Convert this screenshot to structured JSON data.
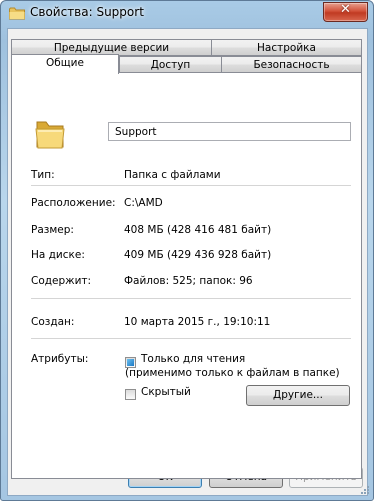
{
  "window": {
    "title": "Свойства: Support",
    "close_label": "✕"
  },
  "tabs_row1": [
    {
      "label": "Предыдущие версии"
    },
    {
      "label": "Настройка"
    }
  ],
  "tabs_row2": [
    {
      "label": "Общие",
      "active": true
    },
    {
      "label": "Доступ"
    },
    {
      "label": "Безопасность"
    }
  ],
  "general": {
    "name_value": "Support",
    "type": {
      "label": "Тип:",
      "value": "Папка с файлами"
    },
    "location": {
      "label": "Расположение:",
      "value": "C:\\AMD"
    },
    "size": {
      "label": "Размер:",
      "value": "408 МБ (428 416 481 байт)"
    },
    "on_disk": {
      "label": "На диске:",
      "value": "409 МБ (429 436 928 байт)"
    },
    "contains": {
      "label": "Содержит:",
      "value": "Файлов: 525; папок: 96"
    },
    "created": {
      "label": "Создан:",
      "value": "10 марта 2015 г., 19:10:11"
    },
    "attributes": {
      "label": "Атрибуты:",
      "readonly_label": "Только для чтения",
      "readonly_note": "(применимо только к файлам в папке)",
      "readonly_state": "indeterminate",
      "hidden_label": "Скрытый",
      "hidden_checked": false,
      "other_button": "Другие..."
    }
  },
  "footer": {
    "ok": "OK",
    "cancel": "Отмена",
    "apply": "Применить"
  },
  "icons": [
    "folder-icon",
    "close-icon",
    "resize-grip-icon"
  ]
}
